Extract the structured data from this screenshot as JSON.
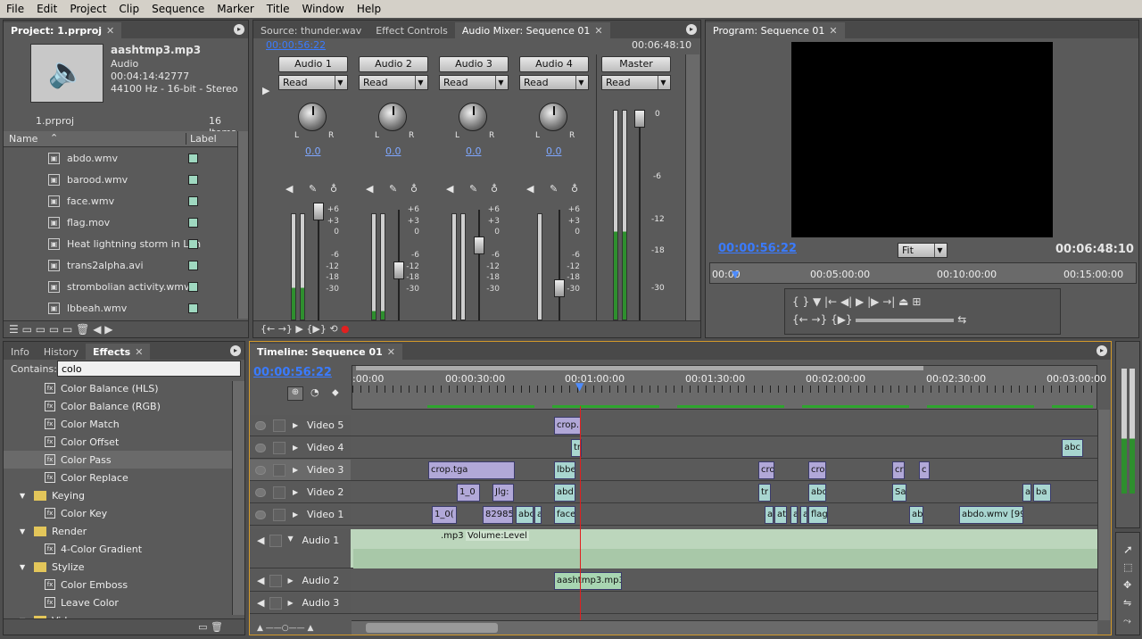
{
  "menu": [
    "File",
    "Edit",
    "Project",
    "Clip",
    "Sequence",
    "Marker",
    "Title",
    "Window",
    "Help"
  ],
  "project": {
    "tab": "Project: 1.prproj",
    "clip_name": "aashtmp3.mp3",
    "clip_type": "Audio",
    "clip_duration": "00:04:14:42777",
    "clip_format": "44100 Hz - 16-bit - Stereo",
    "file": "1.prproj",
    "items": "16 Items",
    "col_name": "Name",
    "col_label": "Label",
    "files": [
      "abdo.wmv",
      "barood.wmv",
      "face.wmv",
      "flag.mov",
      "Heat lightning storm in Lan",
      "trans2alpha.avi",
      "strombolian activity.wmv",
      "lbbeah.wmv"
    ]
  },
  "mixer": {
    "tabs": [
      "Source: thunder.wav",
      "Effect Controls",
      "Audio Mixer: Sequence 01"
    ],
    "tc_left": "00:00:56:22",
    "tc_right": "00:06:48:10",
    "channels": [
      "Audio 1",
      "Audio 2",
      "Audio 3",
      "Audio 4"
    ],
    "master": "Master",
    "mode": "Read",
    "pan_value": "0.0",
    "scale": [
      "+6",
      "+3",
      "0",
      "-6",
      "-12",
      "-18",
      "-30"
    ],
    "master_scale": [
      "0",
      "-6",
      "-12",
      "-18",
      "-30"
    ],
    "l": "L",
    "r": "R"
  },
  "program": {
    "tab": "Program: Sequence 01",
    "tc_current": "00:00:56:22",
    "fit": "Fit",
    "tc_duration": "00:06:48:10",
    "ruler": [
      "00:00",
      "00:05:00:00",
      "00:10:00:00",
      "00:15:00:00"
    ]
  },
  "effects": {
    "tabs": [
      "Info",
      "History",
      "Effects"
    ],
    "contains_label": "Contains:",
    "search": "colo",
    "rows": [
      {
        "t": "e",
        "label": "Color Balance (HLS)"
      },
      {
        "t": "e",
        "label": "Color Balance (RGB)"
      },
      {
        "t": "e",
        "label": "Color Match"
      },
      {
        "t": "e",
        "label": "Color Offset"
      },
      {
        "t": "e",
        "label": "Color Pass"
      },
      {
        "t": "e",
        "label": "Color Replace"
      },
      {
        "t": "f",
        "label": "Keying"
      },
      {
        "t": "e",
        "label": "Color Key"
      },
      {
        "t": "f",
        "label": "Render"
      },
      {
        "t": "e",
        "label": "4-Color Gradient"
      },
      {
        "t": "f",
        "label": "Stylize"
      },
      {
        "t": "e",
        "label": "Color Emboss"
      },
      {
        "t": "e",
        "label": "Leave Color"
      },
      {
        "t": "f",
        "label": "Video"
      }
    ]
  },
  "timeline": {
    "tab": "Timeline: Sequence 01",
    "tc": "00:00:56:22",
    "ruler": ":00:00",
    "r1": "00:00:30:00",
    "r2": "00:01:00:00",
    "r3": "00:01:30:00",
    "r4": "00:02:00:00",
    "r5": "00:02:30:00",
    "r6": "00:03:00:00",
    "tracks": [
      "Video 5",
      "Video 4",
      "Video 3",
      "Video 2",
      "Video 1",
      "Audio 1",
      "Audio 2",
      "Audio 3"
    ],
    "volume": "Volume:Level",
    "clips": {
      "v5a": "crop.",
      "v4a": "tr",
      "v4b": "abc",
      "v3a": "crop.tga",
      "v3b": "lbbe",
      "v3c": "cro",
      "v3d": "cro",
      "v3e": "cr",
      "v3f": "c",
      "v2a": "1_0",
      "v2b": "Jlg:",
      "v2c": "abd",
      "v2d": "tr",
      "v2e": "abo",
      "v2f": "Sa",
      "v2g": "a",
      "v2h": "ba",
      "v1a": "1_0(",
      "v1b": "82985",
      "v1c": "abc",
      "v1d": "a",
      "v1e": "face",
      "v1f": "a",
      "v1g": "at",
      "v1h": "a",
      "v1i": "a",
      "v1j": "flag",
      "v1k": "ab",
      "v1l": "abdo.wmv [99",
      "a1a": ".mp3",
      "a2a": "aashtmp3.mp3"
    }
  }
}
